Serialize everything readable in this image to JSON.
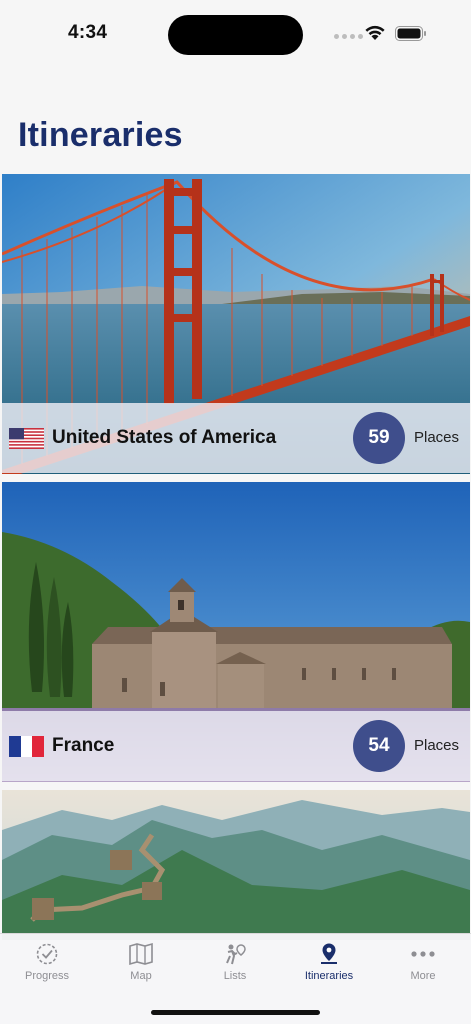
{
  "status_bar": {
    "time": "4:34"
  },
  "page_title": "Itineraries",
  "cards": [
    {
      "country": "United States of America",
      "places_count": "59",
      "places_label": "Places",
      "flag": "us-flag-icon"
    },
    {
      "country": "France",
      "places_count": "54",
      "places_label": "Places",
      "flag": "fr-flag-icon"
    },
    {
      "country": "",
      "image": "great-wall-image"
    }
  ],
  "tabs": [
    {
      "label": "Progress",
      "icon": "progress-icon",
      "active": false
    },
    {
      "label": "Map",
      "icon": "map-icon",
      "active": false
    },
    {
      "label": "Lists",
      "icon": "lists-icon",
      "active": false
    },
    {
      "label": "Itineraries",
      "icon": "itineraries-icon",
      "active": true
    },
    {
      "label": "More",
      "icon": "more-icon",
      "active": false
    }
  ],
  "colors": {
    "title": "#1a2e6b",
    "badge": "#3f4e8c",
    "active_tab": "#1a2e6b",
    "inactive_tab": "#8e8e93"
  }
}
